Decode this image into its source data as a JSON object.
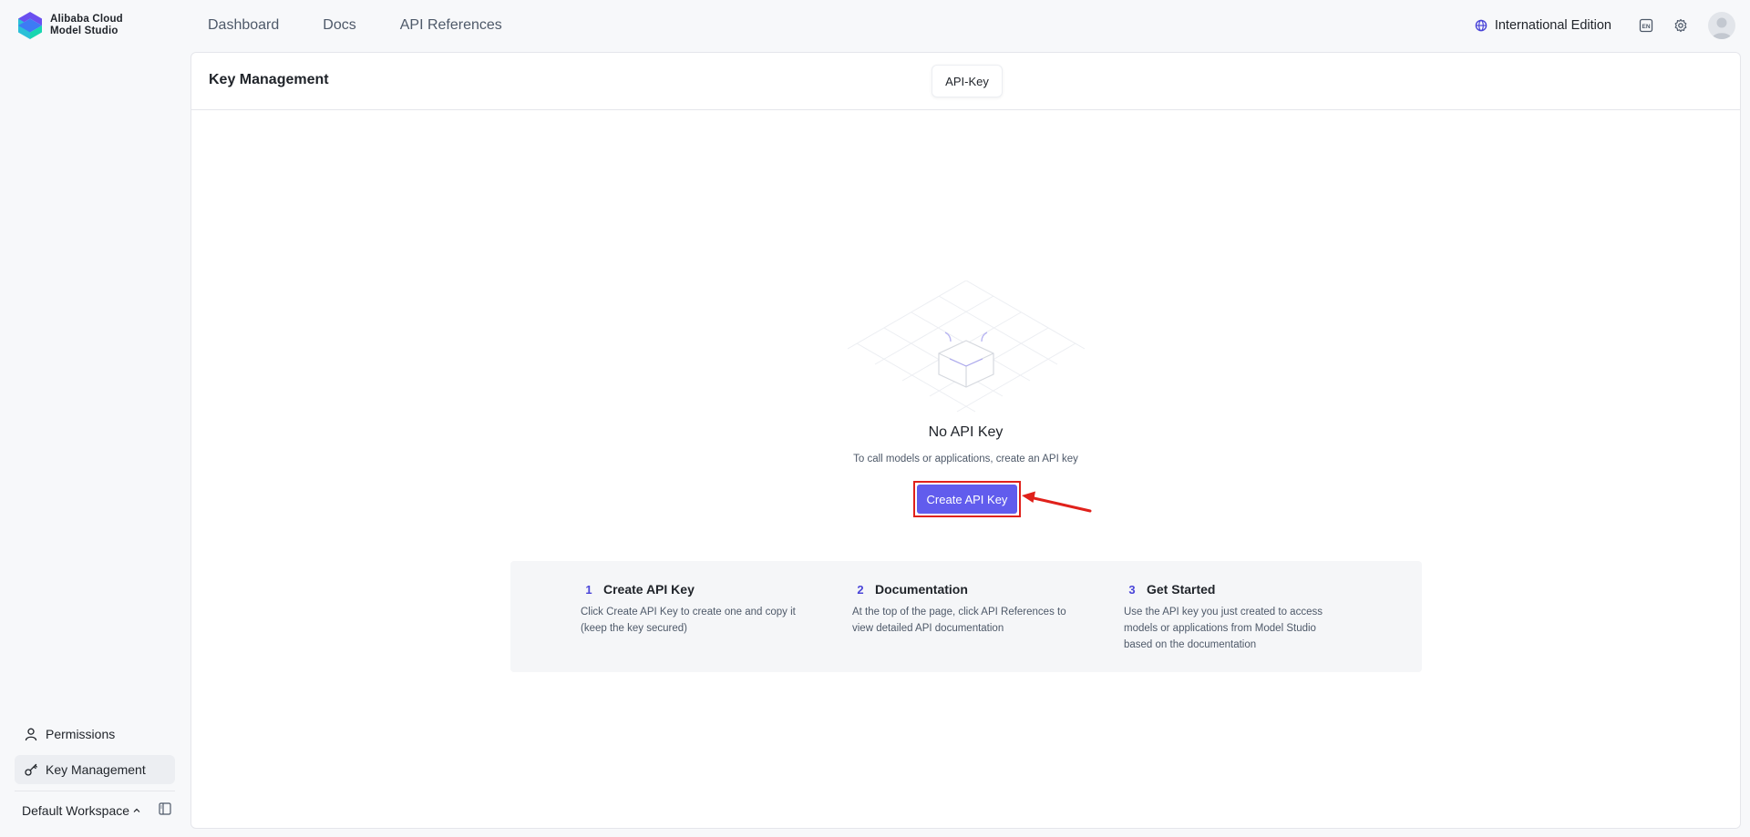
{
  "brand": {
    "line1": "Alibaba Cloud",
    "line2": "Model Studio"
  },
  "topnav": {
    "items": [
      "Dashboard",
      "Docs",
      "API References"
    ]
  },
  "header_right": {
    "edition": "International Edition",
    "lang_badge": "EN"
  },
  "sidebar": {
    "items": [
      {
        "label": "Permissions",
        "icon": "user-icon",
        "active": false
      },
      {
        "label": "Key Management",
        "icon": "key-icon",
        "active": true
      }
    ],
    "workspace": "Default Workspace"
  },
  "main": {
    "title": "Key Management",
    "tab": "API-Key",
    "empty": {
      "title": "No API Key",
      "subtitle": "To call models or applications, create an API key",
      "button": "Create API Key"
    },
    "steps": [
      {
        "num": "1",
        "title": "Create API Key",
        "desc": "Click Create API Key to create one and copy it (keep the key secured)"
      },
      {
        "num": "2",
        "title": "Documentation",
        "desc": "At the top of the page, click API References to view detailed API documentation"
      },
      {
        "num": "3",
        "title": "Get Started",
        "desc": "Use the API key you just created to access models or applications from Model Studio based on the documentation"
      }
    ]
  },
  "colors": {
    "accent": "#615ced",
    "highlight": "#e0211b",
    "page_bg": "#f7f8fa"
  }
}
